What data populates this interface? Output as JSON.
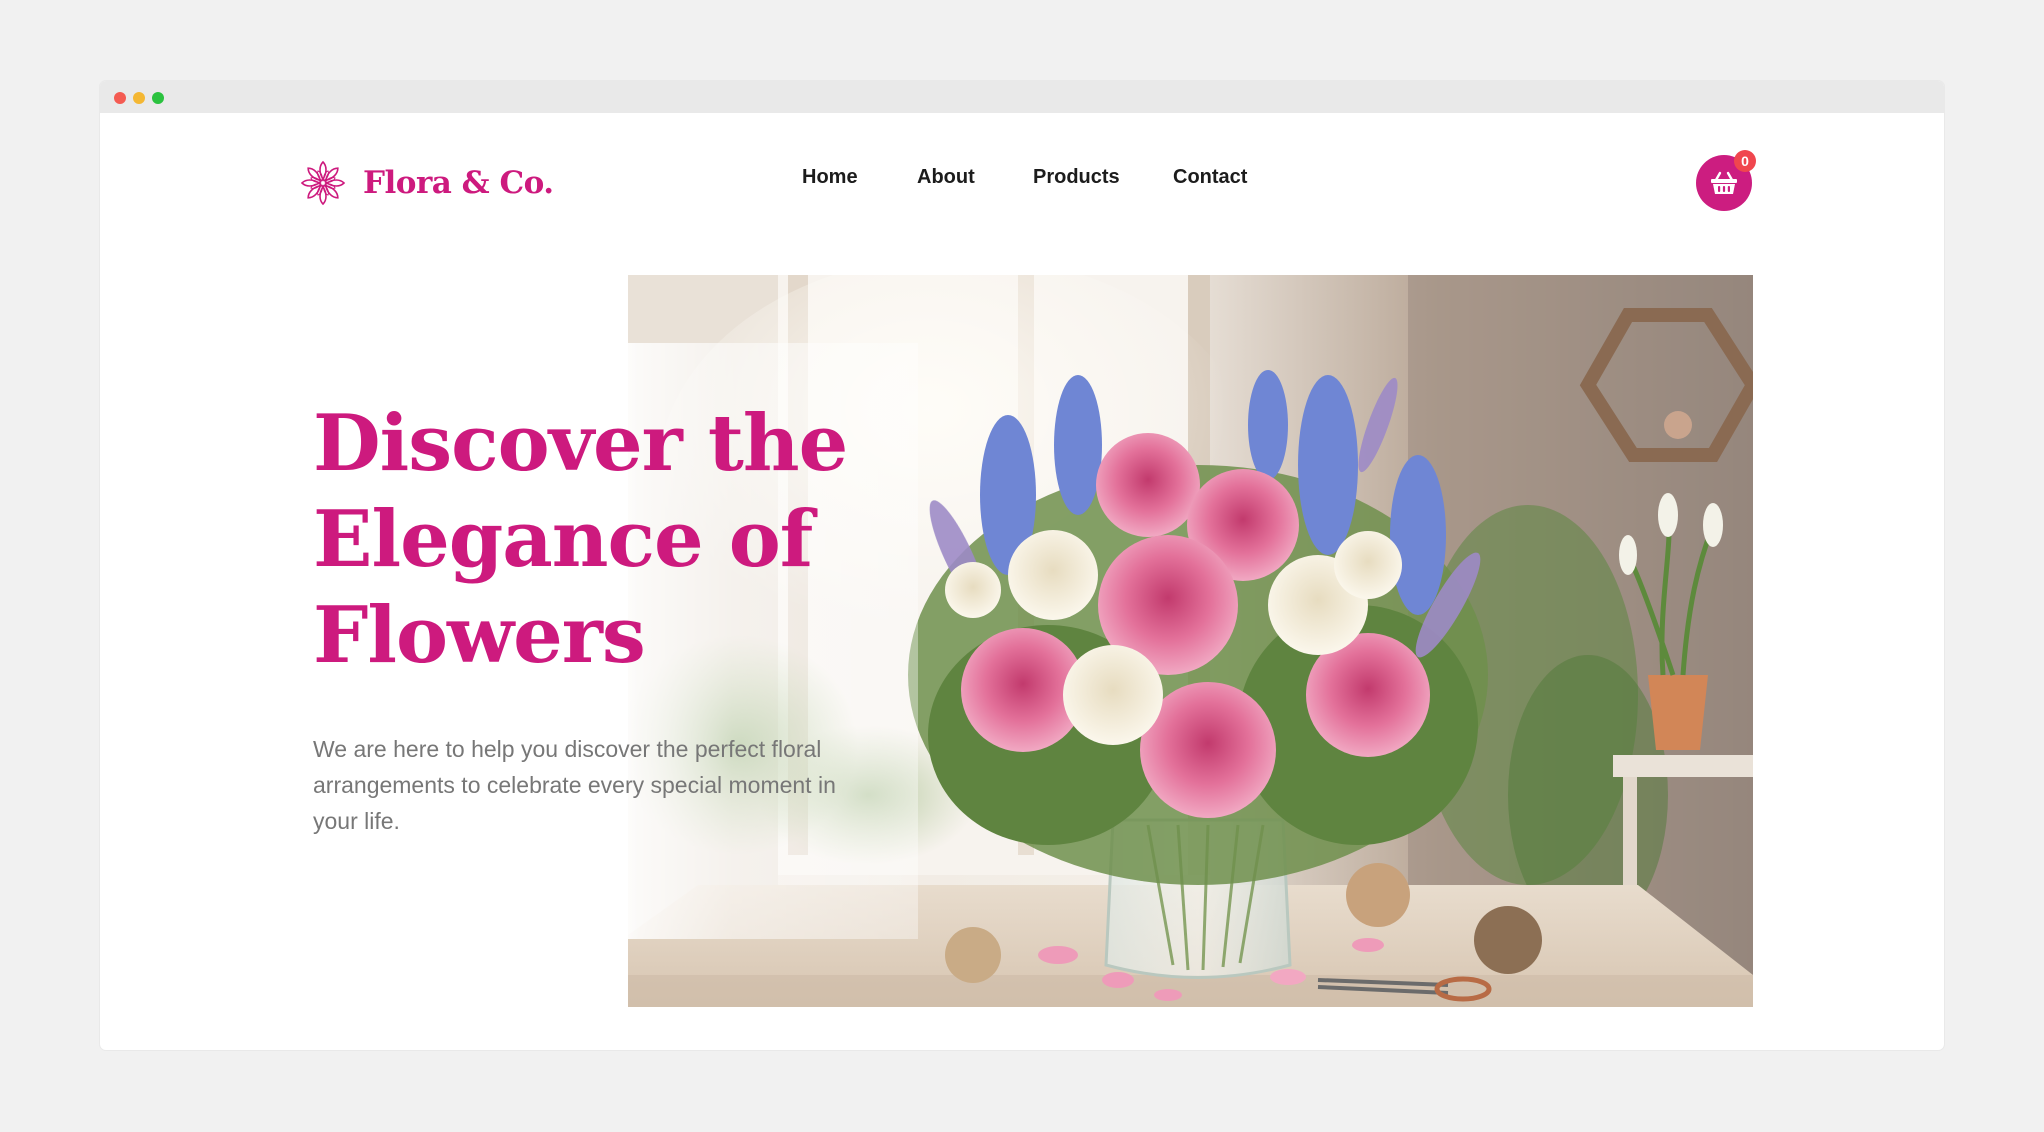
{
  "window": {
    "controls": [
      "close",
      "minimize",
      "maximize"
    ]
  },
  "brand": {
    "name": "Flora & Co.",
    "icon": "flower-logo-icon",
    "color": "#cd1a7e"
  },
  "nav": {
    "items": [
      {
        "label": "Home"
      },
      {
        "label": "About"
      },
      {
        "label": "Products"
      },
      {
        "label": "Contact"
      }
    ]
  },
  "cart": {
    "icon": "basket-icon",
    "count": "0",
    "color": "#cc1d80",
    "badge_color": "#f0464e"
  },
  "hero": {
    "title": "Discover the Elegance of Flowers",
    "description": "We are here to help you discover the perfect floral arrangements to celebrate every special moment in your life.",
    "image": "flower-bouquet-photo"
  }
}
